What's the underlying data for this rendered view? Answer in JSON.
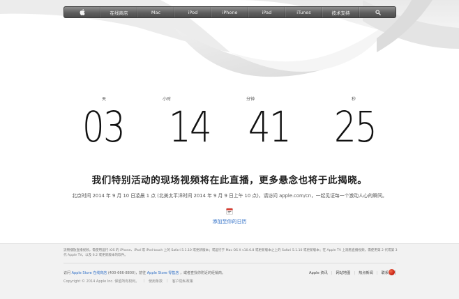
{
  "nav": {
    "items": [
      {
        "label": "",
        "icon": "apple-logo-icon"
      },
      {
        "label": "在线商店"
      },
      {
        "label": "Mac"
      },
      {
        "label": "iPod"
      },
      {
        "label": "iPhone"
      },
      {
        "label": "iPad"
      },
      {
        "label": "iTunes"
      },
      {
        "label": "技术支持"
      },
      {
        "label": "",
        "icon": "search-icon"
      }
    ]
  },
  "countdown": {
    "days": {
      "label": "天",
      "value": "03"
    },
    "hours": {
      "label": "小时",
      "value": "14"
    },
    "minutes": {
      "label": "分钟",
      "value": "41"
    },
    "seconds": {
      "label": "秒",
      "value": "25"
    }
  },
  "event": {
    "headline": "我们特别活动的现场视频将在此直播，更多悬念也将于此揭晓。",
    "subline": "北京时间 2014 年 9 月 10 日凌晨 1 点 (北美太平洋时间 2014 年 9 月 9 日上午 10 点)，请访问 apple.com/cn，一起见证每一个激动人心的瞬间。",
    "calendar_icon": "calendar-icon",
    "calendar_link": "添加至你的日历"
  },
  "footer": {
    "footnote": "流畅播放直播视频，需使用运行 iOS 的 iPhone、iPad 或 iPod touch 上的 Safari 5.1.10 或更新版本；或运行于 Mac OS X v10.6.8 或更新版本之上的 Safari 5.1.10 或更新版本；在 Apple TV 上观看直播视频，需使用第 2 代或第 3 代 Apple TV，以及 6.2 或更新版本的软件。",
    "line1_prefix": "访问",
    "store_link": "Apple Store 在线商店",
    "line1_middle": "(400-666-8800)，前往",
    "retail_link": "Apple Store 零售店",
    "line1_suffix": "，或者查找你附近的经销商。",
    "copyright": "Copyright © 2014 Apple Inc. 保留所有权利。",
    "terms": "使用条款",
    "privacy": "客户隐私政策",
    "right_links": [
      "Apple 资讯",
      "网站地图",
      "热点新闻",
      "联系我们"
    ],
    "flag_icon": "china-flag-icon"
  }
}
